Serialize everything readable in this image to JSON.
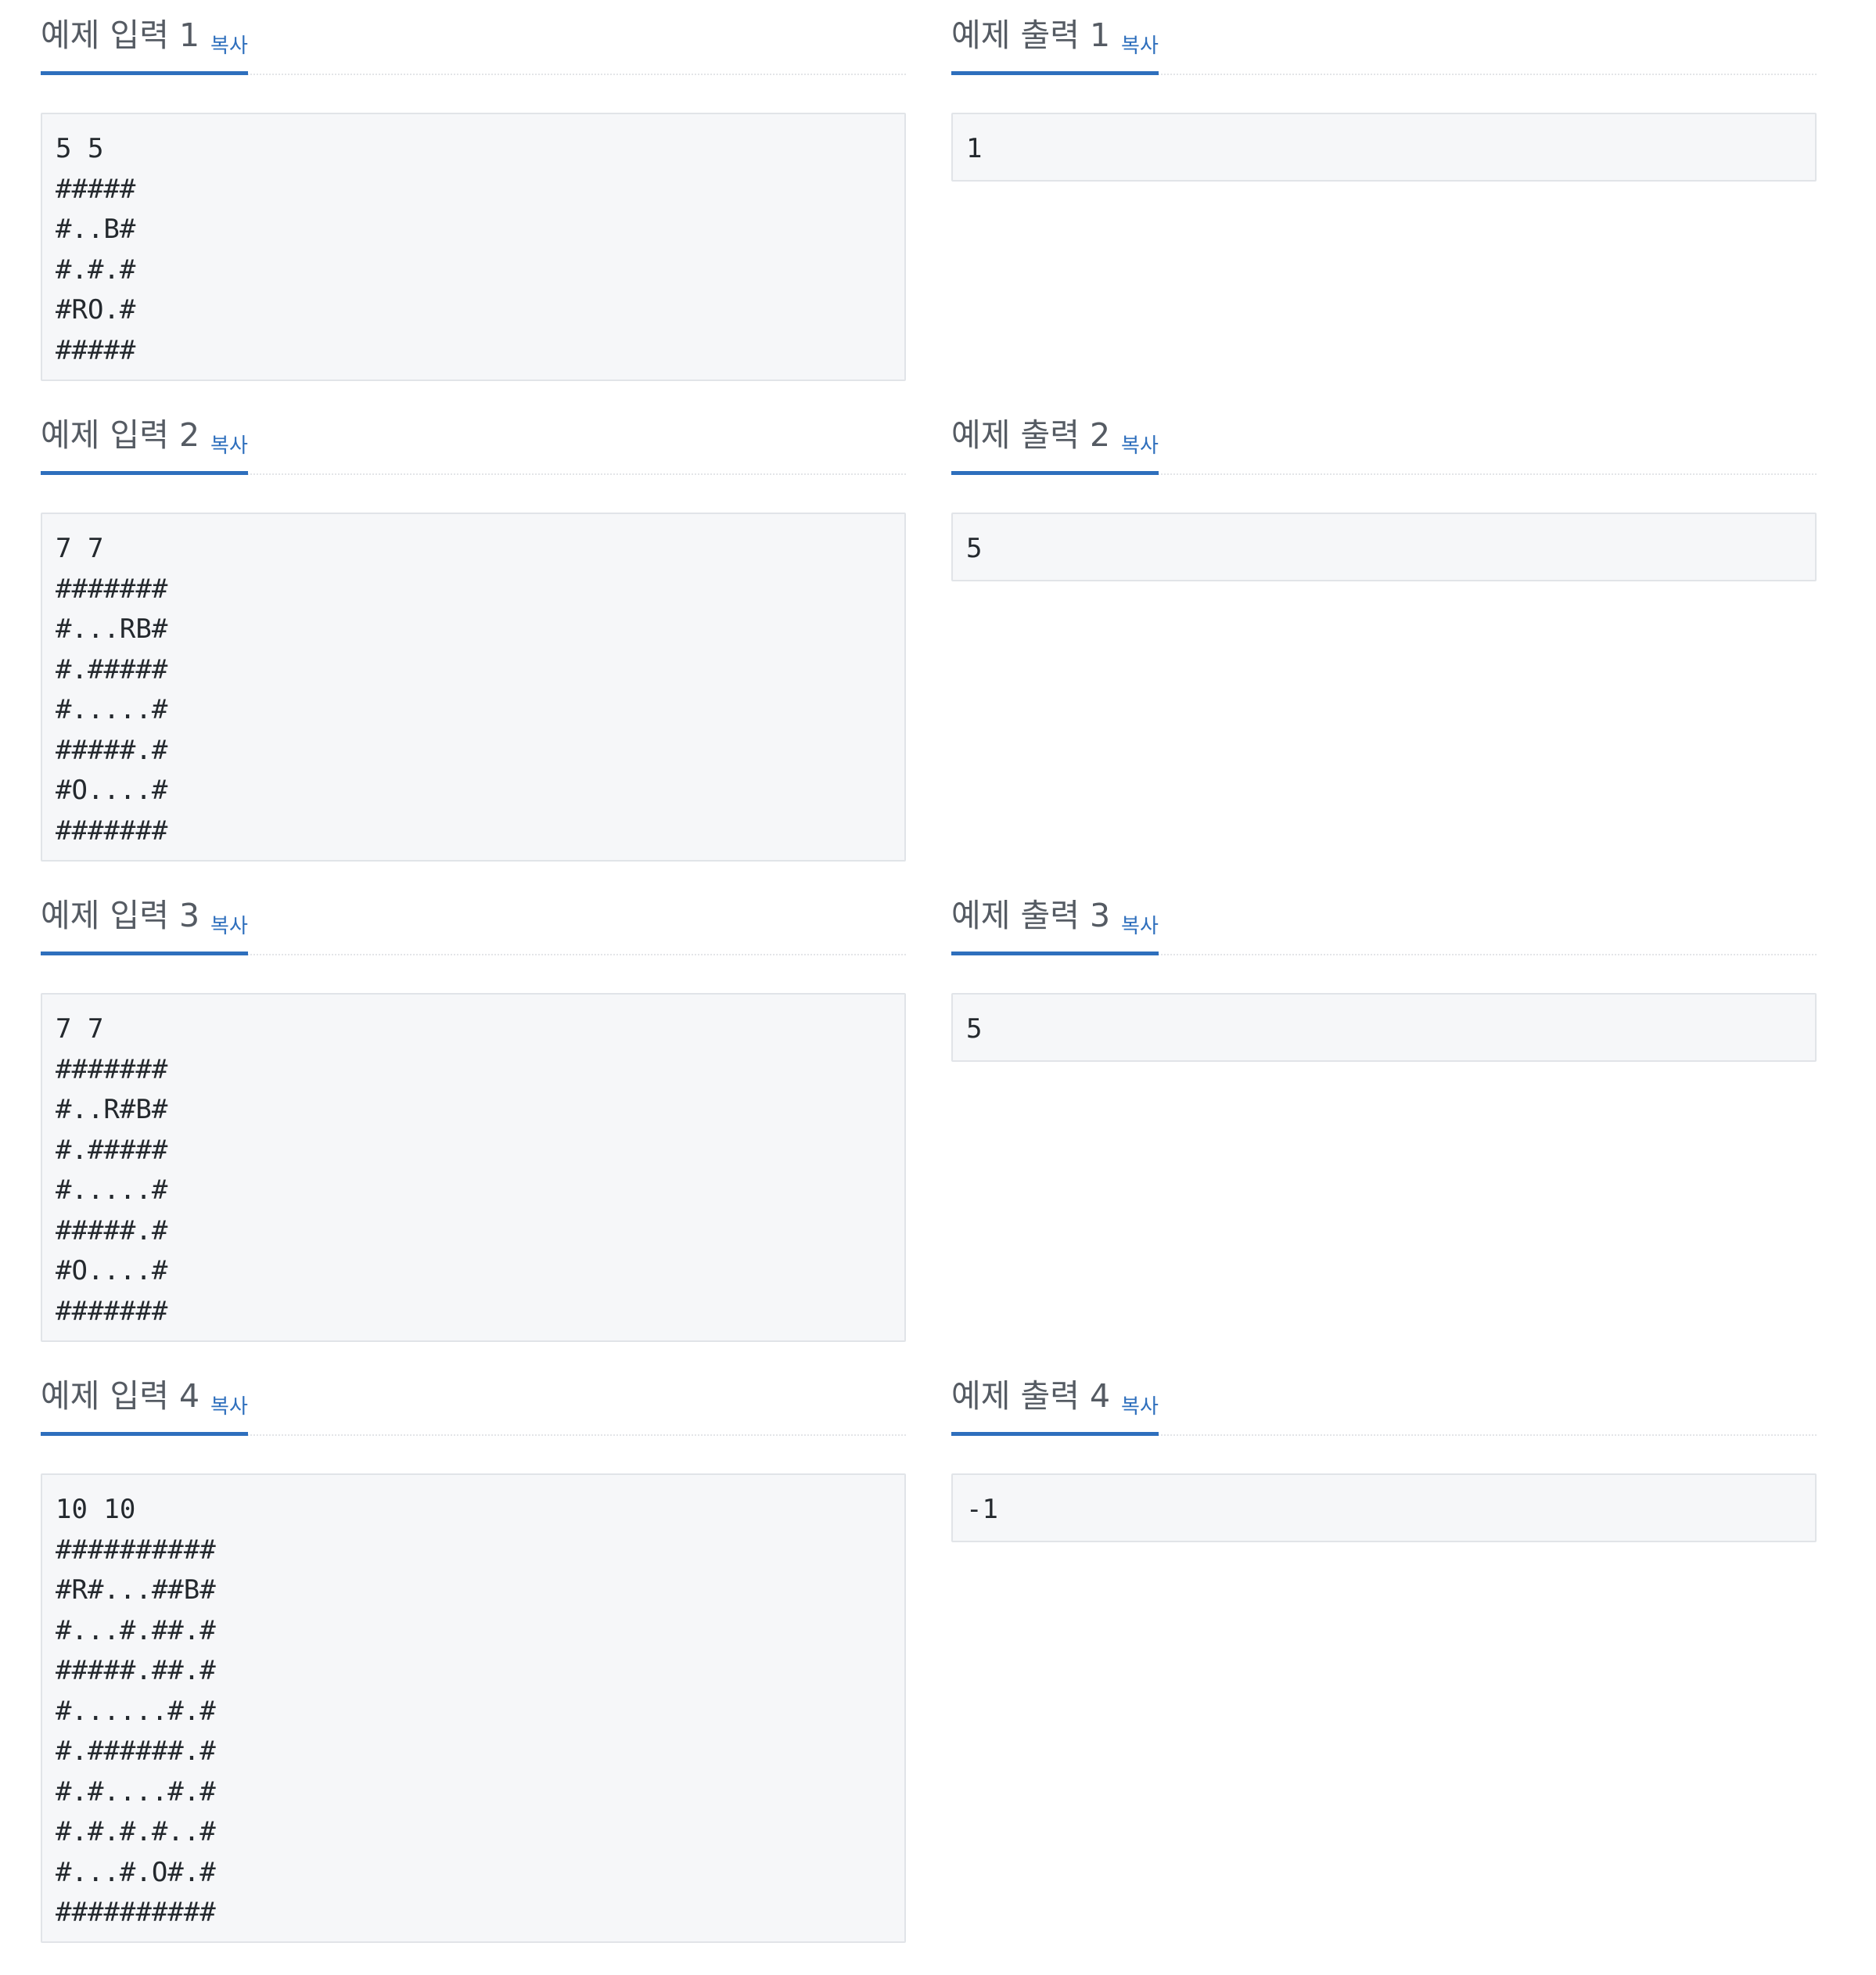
{
  "copy_label": "복사",
  "samples": [
    {
      "input_title": "예제 입력 1",
      "input_lines": [
        "5 5",
        "#####",
        "#..B#",
        "#.#.#",
        "#RO.#",
        "#####"
      ],
      "output_title": "예제 출력 1",
      "output_lines": [
        "1"
      ]
    },
    {
      "input_title": "예제 입력 2",
      "input_lines": [
        "7 7",
        "#######",
        "#...RB#",
        "#.#####",
        "#.....#",
        "#####.#",
        "#O....#",
        "#######"
      ],
      "output_title": "예제 출력 2",
      "output_lines": [
        "5"
      ]
    },
    {
      "input_title": "예제 입력 3",
      "input_lines": [
        "7 7",
        "#######",
        "#..R#B#",
        "#.#####",
        "#.....#",
        "#####.#",
        "#O....#",
        "#######"
      ],
      "output_title": "예제 출력 3",
      "output_lines": [
        "5"
      ]
    },
    {
      "input_title": "예제 입력 4",
      "input_lines": [
        "10 10",
        "##########",
        "#R#...##B#",
        "#...#.##.#",
        "#####.##.#",
        "#......#.#",
        "#.######.#",
        "#.#....#.#",
        "#.#.#.#..#",
        "#...#.O#.#",
        "##########"
      ],
      "output_title": "예제 출력 4",
      "output_lines": [
        "-1"
      ]
    }
  ]
}
